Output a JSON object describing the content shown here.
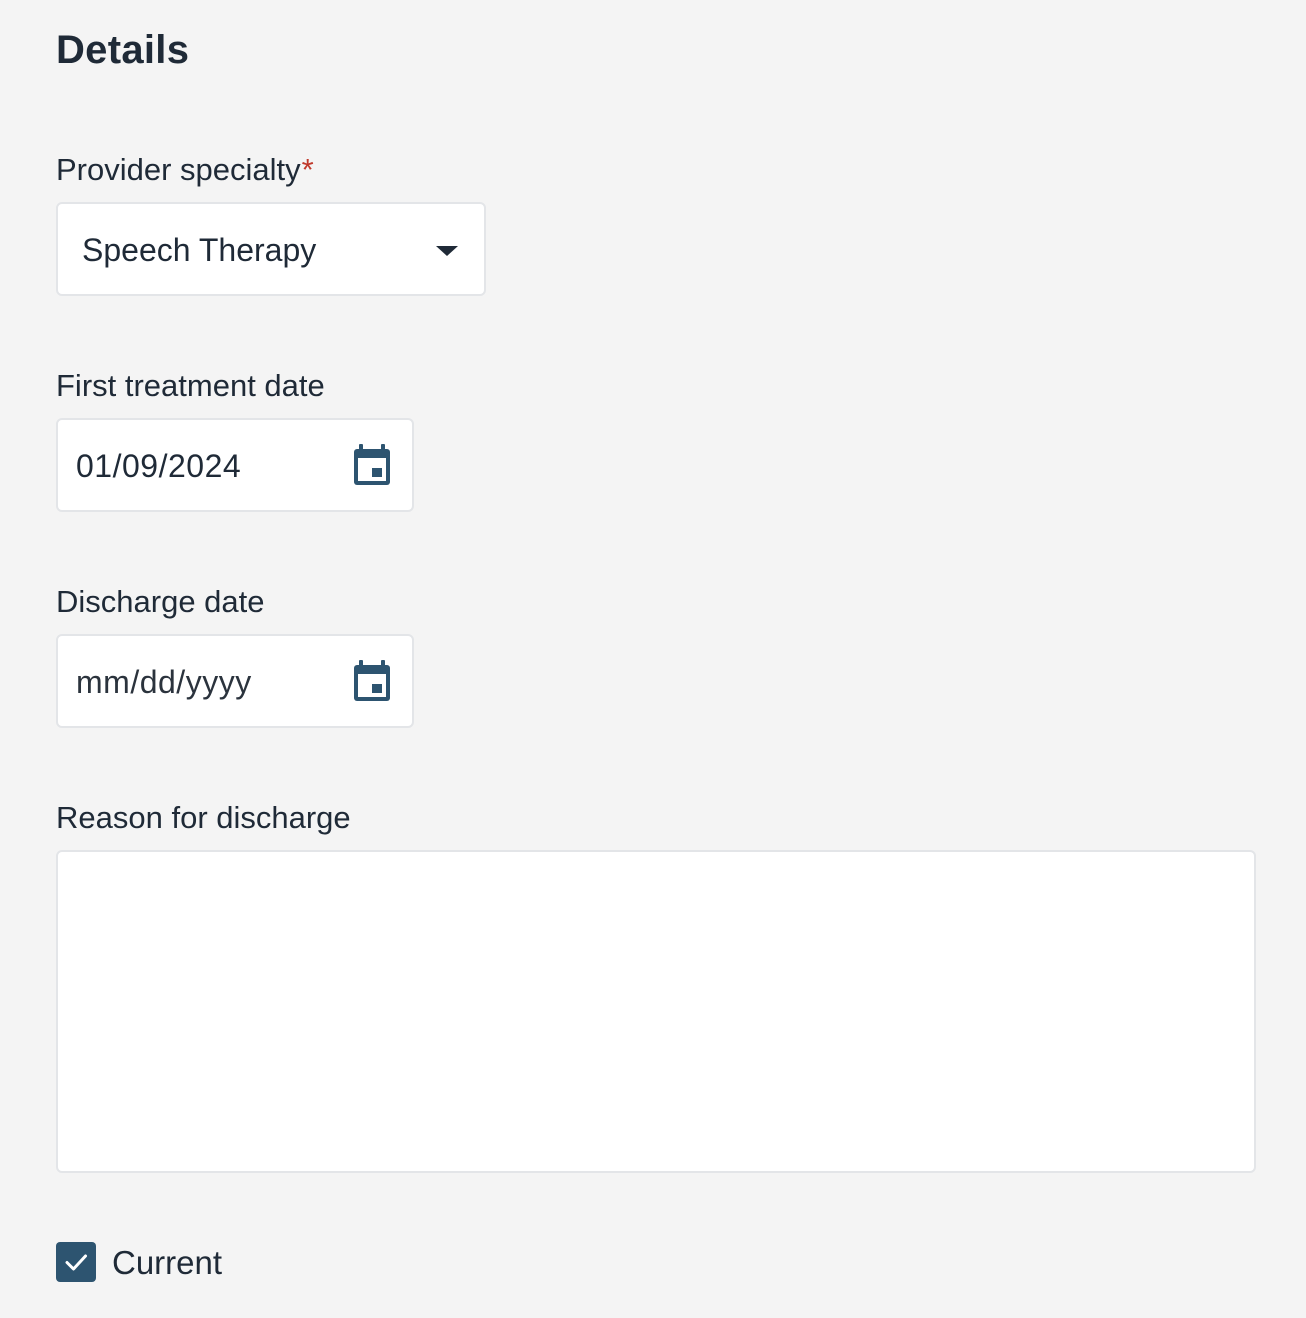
{
  "section": {
    "title": "Details"
  },
  "provider_specialty": {
    "label": "Provider specialty",
    "required_mark": "*",
    "selected_value": "Speech Therapy",
    "icon": "chevron-down-icon"
  },
  "first_treatment_date": {
    "label": "First treatment date",
    "value": "01/09/2024",
    "icon": "calendar-icon"
  },
  "discharge_date": {
    "label": "Discharge date",
    "placeholder": "mm/dd/yyyy",
    "icon": "calendar-icon"
  },
  "reason_for_discharge": {
    "label": "Reason for discharge",
    "value": ""
  },
  "current_checkbox": {
    "label": "Current",
    "checked": true,
    "icon": "checkmark-icon"
  },
  "colors": {
    "accent": "#2d5470",
    "required": "#c0392b",
    "background": "#f4f4f4",
    "field_border": "#e3e5e8"
  }
}
